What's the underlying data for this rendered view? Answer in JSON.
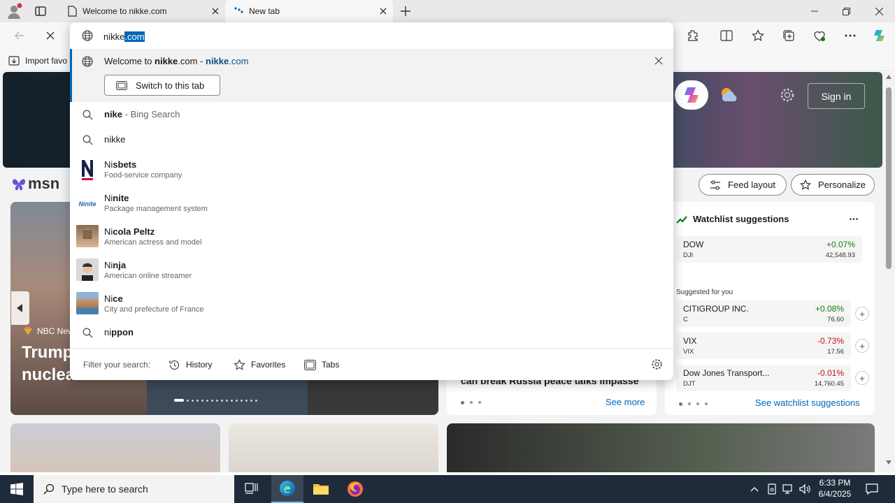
{
  "browser": {
    "tabs": [
      {
        "title": "Welcome to nikke.com",
        "active": false
      },
      {
        "title": "New tab",
        "active": true
      }
    ],
    "address": {
      "typed": "nikke",
      "autocomplete": ".com"
    },
    "favbar": {
      "import_label": "Import favo"
    }
  },
  "dropdown": {
    "open_tab": {
      "prefix": "Welcome to ",
      "bold": "nikke",
      "rest": ".com - ",
      "url_bold": "nikke",
      "url_rest": ".com",
      "switch_label": "Switch to this tab"
    },
    "suggestions": [
      {
        "type": "search",
        "bold": "nike",
        "rest": "",
        "suffix": " - Bing Search"
      },
      {
        "type": "search",
        "bold": "",
        "rest": "nikke",
        "suffix": ""
      },
      {
        "type": "entity",
        "match": "Ni",
        "rest": "sbets",
        "subtitle": "Food-service company",
        "icon": "nisbets-logo"
      },
      {
        "type": "entity",
        "match": "Ni",
        "rest": "nite",
        "subtitle": "Package management system",
        "icon": "ninite-logo"
      },
      {
        "type": "entity",
        "match": "Ni",
        "rest": "cola Peltz",
        "subtitle": "American actress and model",
        "icon": "person-photo"
      },
      {
        "type": "entity",
        "match": "Ni",
        "rest": "nja",
        "subtitle": "American online streamer",
        "icon": "person-photo"
      },
      {
        "type": "entity",
        "match": "Ni",
        "rest": "ce",
        "subtitle": "City and prefecture of France",
        "icon": "city-photo"
      },
      {
        "type": "search",
        "bold": "",
        "match": "ni",
        "rest": "ppon",
        "suffix": ""
      }
    ],
    "filter": {
      "label": "Filter your search:",
      "options": [
        "History",
        "Favorites",
        "Tabs"
      ]
    }
  },
  "msn": {
    "logo": "msn",
    "sign_in": "Sign in",
    "feed_layout": "Feed layout",
    "personalize": "Personalize",
    "hero": {
      "source": "NBC New",
      "headline_line1": "Trump",
      "headline_line2": "nuclea"
    },
    "news_fragment": "can break Russia peace talks impasse",
    "see_more": "See more",
    "watchlist": {
      "title": "Watchlist suggestions",
      "rows": [
        {
          "name": "DOW",
          "symbol": "DJI",
          "change": "+0.07%",
          "price": "42,548.93",
          "up": true
        }
      ],
      "suggested_label": "Suggested for you",
      "suggested": [
        {
          "name": "CITIGROUP INC.",
          "symbol": "C",
          "change": "+0.08%",
          "price": "76.60",
          "up": true
        },
        {
          "name": "VIX",
          "symbol": "VIX",
          "change": "-0.73%",
          "price": "17.56",
          "up": false
        },
        {
          "name": "Dow Jones Transport...",
          "symbol": "DJT",
          "change": "-0.01%",
          "price": "14,760.45",
          "up": false
        }
      ],
      "see_link": "See watchlist suggestions"
    }
  },
  "taskbar": {
    "search_placeholder": "Type here to search",
    "time": "6:33 PM",
    "date": "6/4/2025"
  },
  "colors": {
    "accent": "#0067b8",
    "positive": "#107c10",
    "negative": "#c50f1f",
    "taskbar": "#1f2b3a"
  }
}
